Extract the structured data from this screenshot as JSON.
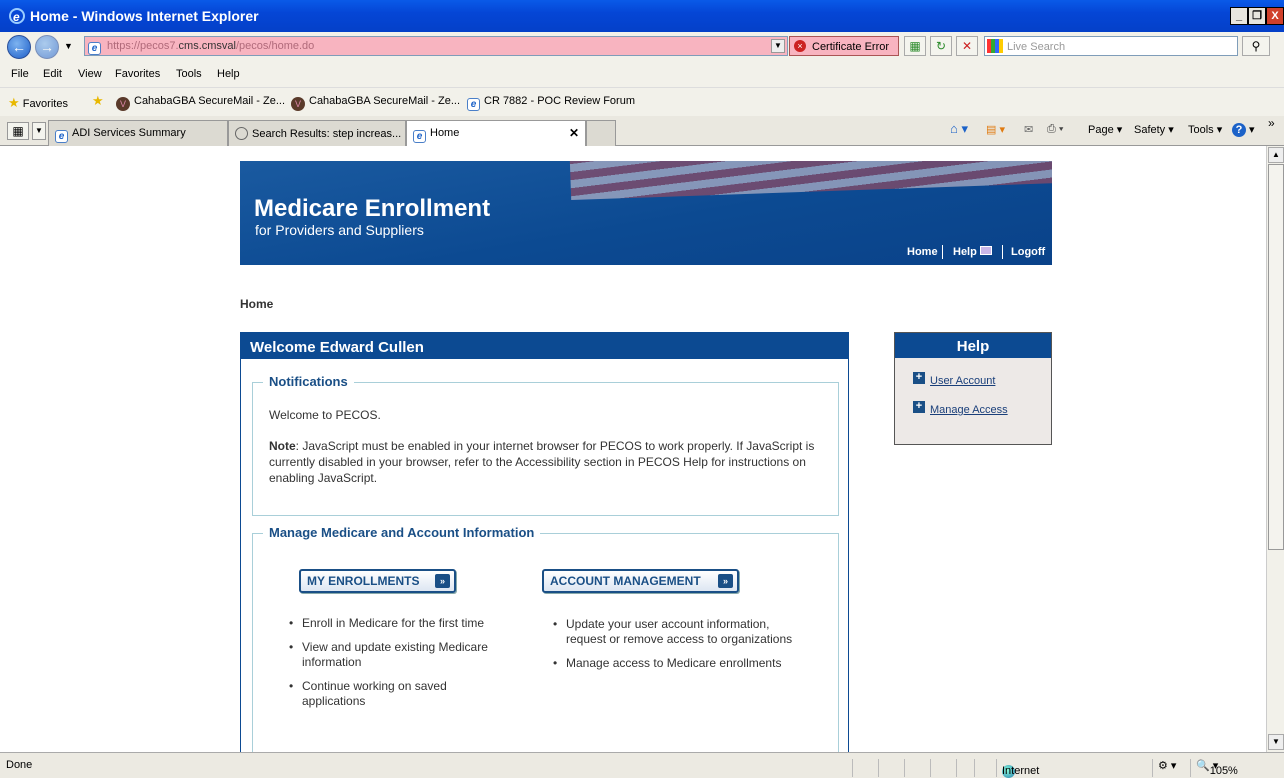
{
  "window": {
    "title": "Home - Windows Internet Explorer",
    "btn_min": "_",
    "btn_max": "❐",
    "btn_close": "X"
  },
  "address": {
    "url_prefix": "https://pecos7.",
    "url_host": "cms.cmsval",
    "url_path": "/pecos/home.do",
    "cert_error": "Certificate Error",
    "search_placeholder": "Live Search"
  },
  "menu": [
    "File",
    "Edit",
    "View",
    "Favorites",
    "Tools",
    "Help"
  ],
  "favorites": {
    "label": "Favorites",
    "items": [
      "CahabaGBA SecureMail - Ze...",
      "CahabaGBA SecureMail - Ze...",
      "CR 7882 - POC Review Forum"
    ]
  },
  "tabs": [
    "ADI Services Summary",
    "Search Results: step increas...",
    "Home"
  ],
  "commands": {
    "page": "Page",
    "safety": "Safety",
    "tools": "Tools"
  },
  "status": {
    "left": "Done",
    "zone": "Internet",
    "zoom": "105%"
  },
  "banner": {
    "title": "Medicare Enrollment",
    "subtitle": "for Providers and Suppliers",
    "nav_home": "Home",
    "nav_help": "Help",
    "nav_logoff": "Logoff"
  },
  "breadcrumb": "Home",
  "welcome": {
    "heading": "Welcome Edward Cullen",
    "notifications": {
      "legend": "Notifications",
      "line1": "Welcome to PECOS.",
      "note_label": "Note",
      "note_text": ": JavaScript must be enabled in your internet browser for PECOS to work properly. If JavaScript is currently disabled in your browser, refer to the Accessibility section in PECOS Help for instructions on enabling JavaScript."
    },
    "manage": {
      "legend": "Manage Medicare and Account Information",
      "enrollments_btn": "MY ENROLLMENTS",
      "account_btn": "ACCOUNT MANAGEMENT",
      "enroll_bullets": [
        "Enroll in Medicare for the first time",
        "View and update existing Medicare information",
        "Continue working on saved applications"
      ],
      "account_bullets": [
        "Update your user account information, request or remove access to organizations",
        "Manage access to Medicare enrollments"
      ]
    }
  },
  "help": {
    "heading": "Help",
    "links": [
      "User Account",
      "Manage Access"
    ]
  }
}
